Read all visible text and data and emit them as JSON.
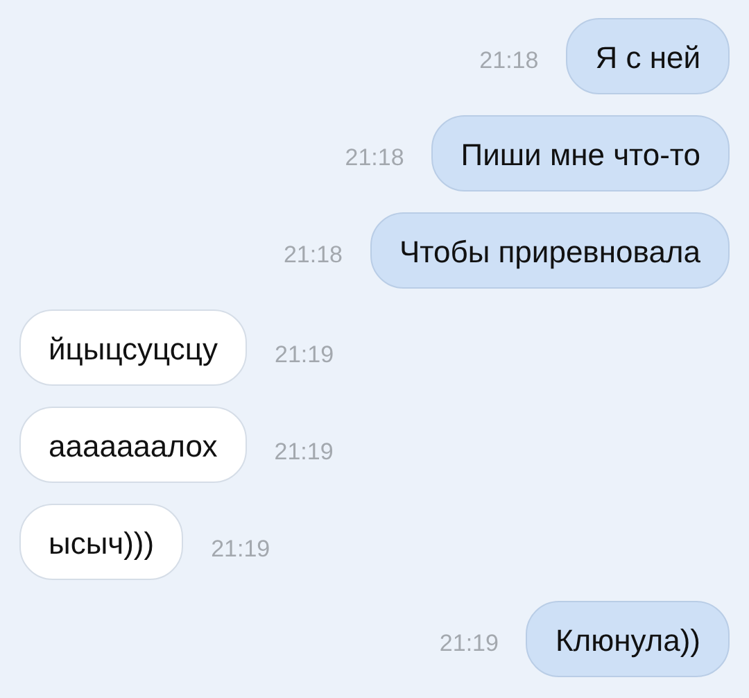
{
  "messages": [
    {
      "kind": "outgoing",
      "text": "Я с ней",
      "time": "21:18"
    },
    {
      "kind": "outgoing",
      "text": "Пиши мне что-то",
      "time": "21:18"
    },
    {
      "kind": "outgoing",
      "text": "Чтобы приревновала",
      "time": "21:18"
    },
    {
      "kind": "incoming",
      "text": "йцыцсуцсцу",
      "time": "21:19"
    },
    {
      "kind": "incoming",
      "text": "ааааааалох",
      "time": "21:19"
    },
    {
      "kind": "incoming",
      "text": "ысыч)))",
      "time": "21:19"
    },
    {
      "kind": "outgoing",
      "text": "Клюнула))",
      "time": "21:19"
    }
  ]
}
